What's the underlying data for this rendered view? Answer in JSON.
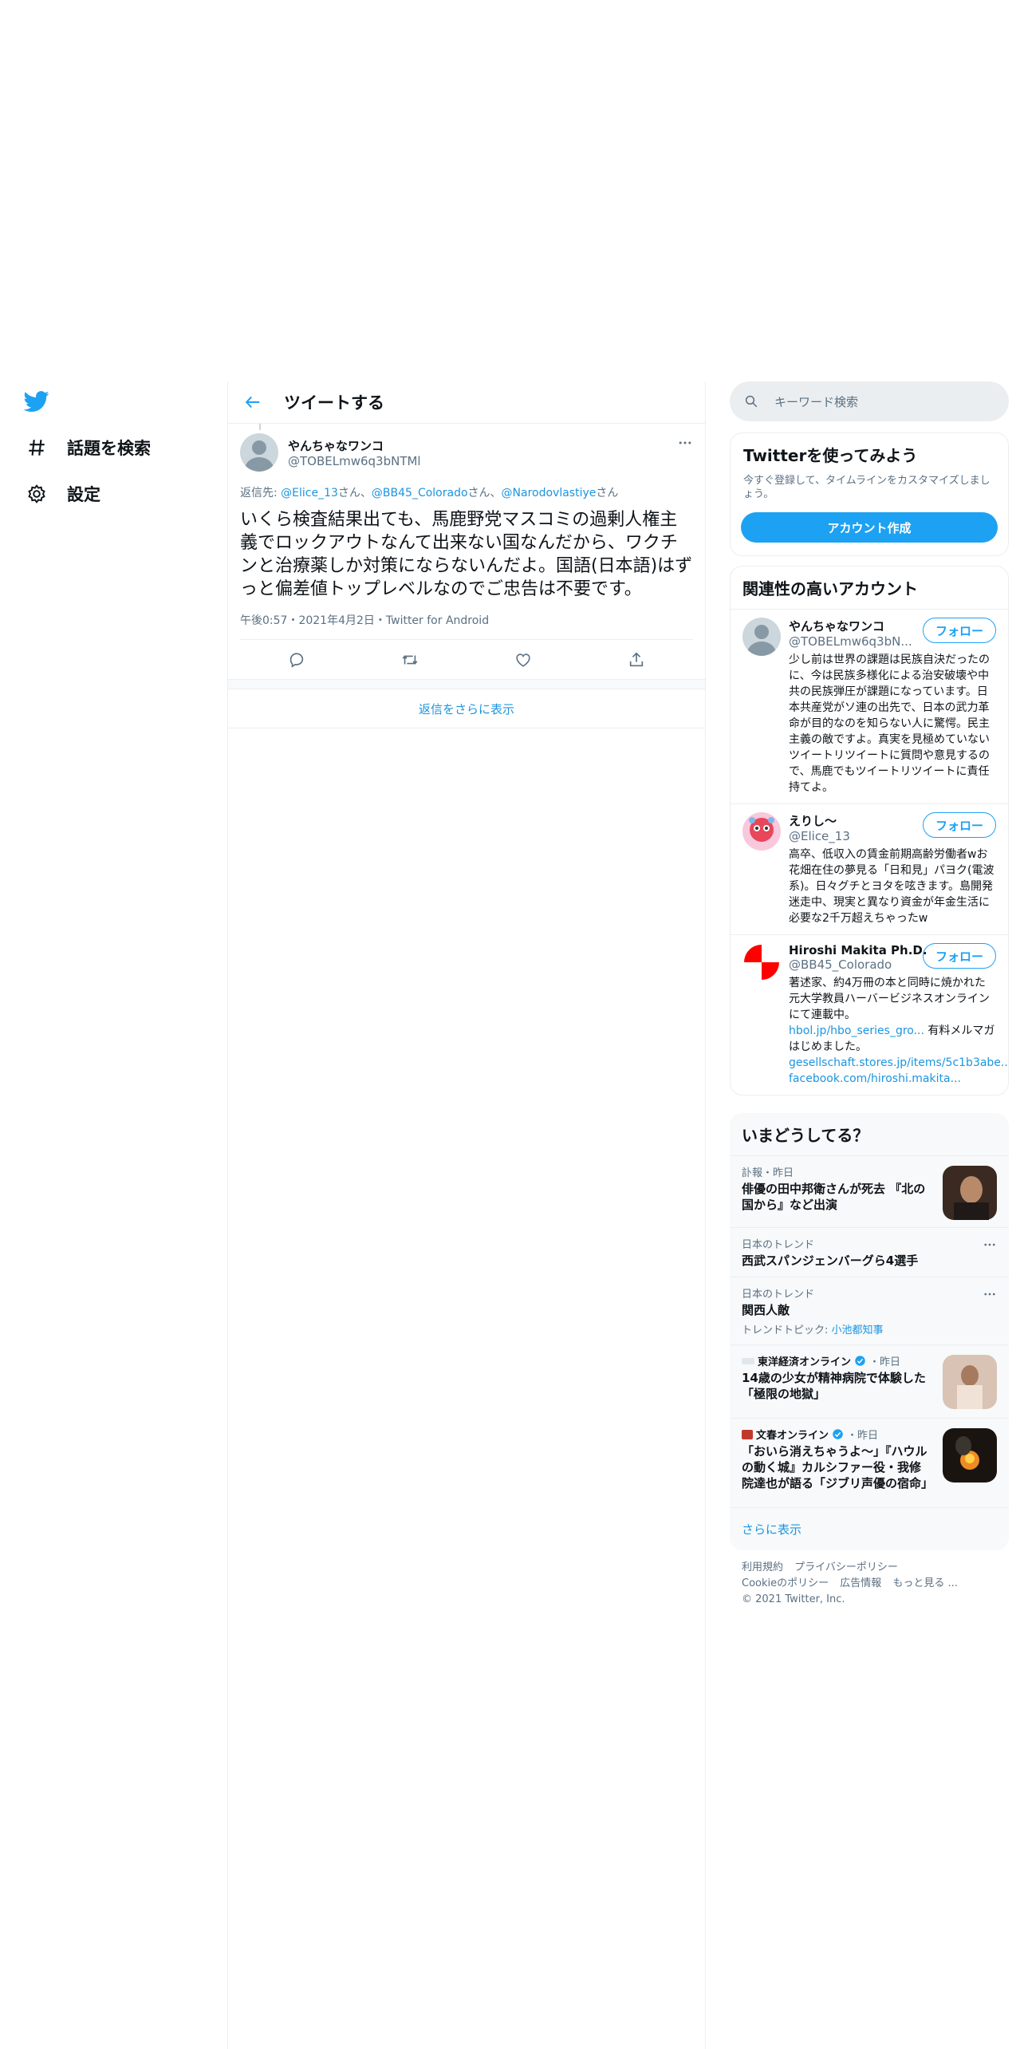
{
  "nav": {
    "items": [
      {
        "label": "話題を検索",
        "icon": "hashtag-icon"
      },
      {
        "label": "設定",
        "icon": "gear-icon"
      }
    ]
  },
  "header": {
    "title": "ツイートする"
  },
  "tweet": {
    "author_name": "やんちゃなワンコ",
    "author_handle": "@TOBELmw6q3bNTMl",
    "reply_prefix": "返信先: ",
    "reply_to": [
      {
        "handle": "@Elice_13",
        "suffix": "さん、"
      },
      {
        "handle": "@BB45_Colorado",
        "suffix": "さん、"
      },
      {
        "handle": "@Narodovlastiye",
        "suffix": "さん"
      }
    ],
    "text": "いくら検査結果出ても、馬鹿野党マスコミの過剰人権主義でロックアウトなんて出来ない国なんだから、ワクチンと治療薬しか対策にならないんだよ。国語(日本語)はずっと偏差値トップレベルなのでご忠告は不要です。",
    "timestamp": "午後0:57・2021年4月2日・Twitter for Android",
    "more_icon": "more-icon",
    "actions": [
      "reply-icon",
      "retweet-icon",
      "like-icon",
      "share-icon"
    ]
  },
  "more_replies_label": "返信をさらに表示",
  "search": {
    "placeholder": "キーワード検索"
  },
  "signup": {
    "title": "Twitterを使ってみよう",
    "desc": "今すぐ登録して、タイムラインをカスタマイズしましょう。",
    "button": "アカウント作成"
  },
  "related": {
    "title": "関連性の高いアカウント",
    "follow_label": "フォロー",
    "accounts": [
      {
        "name": "やんちゃなワンコ",
        "handle": "@TOBELmw6q3bN...",
        "bio": "少し前は世界の課題は民族自決だったのに、今は民族多様化による治安破壊や中共の民族弾圧が課題になっています。日本共産党がソ連の出先で、日本の武力革命が目的なのを知らない人に驚愕。民主主義の敵ですよ。真実を見極めていないツイートリツイートに質問や意見するので、馬鹿でもツイートリツイートに責任持てよ。"
      },
      {
        "name": "えりし～",
        "handle": "@Elice_13",
        "bio": "高卒、低収入の賃金前期高齢労働者wお花畑在住の夢見る「日和見」パヨク(電波系)。日々グチとヨタを呟きます。島開発迷走中、現実と異なり資金が年金生活に必要な2千万超えちゃったw"
      },
      {
        "name": "Hiroshi Makita Ph.D.",
        "handle": "@BB45_Colorado",
        "bio": "著述家、約4万冊の本と同時に焼かれた元大学教員ハーバービジネスオンラインにて連載中。",
        "link1": "hbol.jp/hbo_series_gro...",
        "bio2": " 有料メルマガはじめました。",
        "link2": "gesellschaft.stores.jp/items/5c1b3abe...",
        "link3": " facebook.com/hiroshi.makita..."
      }
    ]
  },
  "trends": {
    "title": "いまどうしてる？",
    "items": [
      {
        "meta": "訃報・昨日",
        "title": "俳優の田中邦衛さんが死去 『北の国から』など出演"
      },
      {
        "meta": "日本のトレンド",
        "title": "西武スパンジェンバーグら4選手"
      },
      {
        "meta": "日本のトレンド",
        "title": "関西人敵",
        "topic_label": "トレンドトピック: ",
        "topic": "小池都知事"
      },
      {
        "source": "東洋経済オンライン",
        "when": "・昨日",
        "title": "14歳の少女が精神病院で体験した「極限の地獄」"
      },
      {
        "source": "文春オンライン",
        "when": "・昨日",
        "title": "「おいら消えちゃうよ～」『ハウルの動く城』カルシファー役・我修院達也が語る「ジブリ声優の宿命」"
      }
    ],
    "show_more": "さらに表示"
  },
  "footer": {
    "links": [
      "利用規約",
      "プライバシーポリシー",
      "Cookieのポリシー",
      "広告情報",
      "もっと見る ..."
    ],
    "copyright": "© 2021 Twitter, Inc."
  },
  "colors": {
    "accent": "#1da1f2",
    "link": "#1b95e0",
    "muted": "#5b7083"
  }
}
